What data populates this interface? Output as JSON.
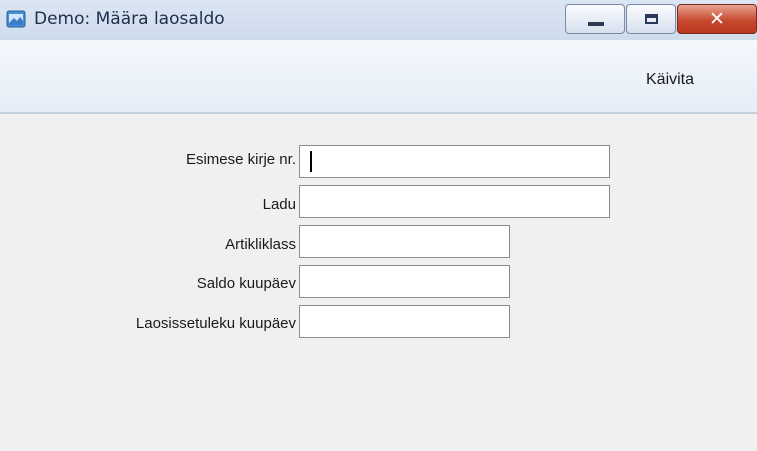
{
  "window": {
    "title": "Demo: Määra laosaldo",
    "minimize_glyph": "",
    "maximize_glyph": "",
    "close_glyph": "✕"
  },
  "toolbar": {
    "run_label": "Käivita"
  },
  "form": {
    "fields": [
      {
        "label": "Esimese kirje nr.",
        "value": "",
        "focused": true
      },
      {
        "label": "Ladu",
        "value": ""
      },
      {
        "label": "Artikliklass",
        "value": ""
      },
      {
        "label": "Saldo kuupäev",
        "value": ""
      },
      {
        "label": "Laosissetuleku kuupäev",
        "value": ""
      }
    ]
  },
  "icons": {
    "app": "app-window-icon",
    "minimize": "minimize-icon",
    "maximize": "maximize-icon",
    "close": "close-icon"
  }
}
